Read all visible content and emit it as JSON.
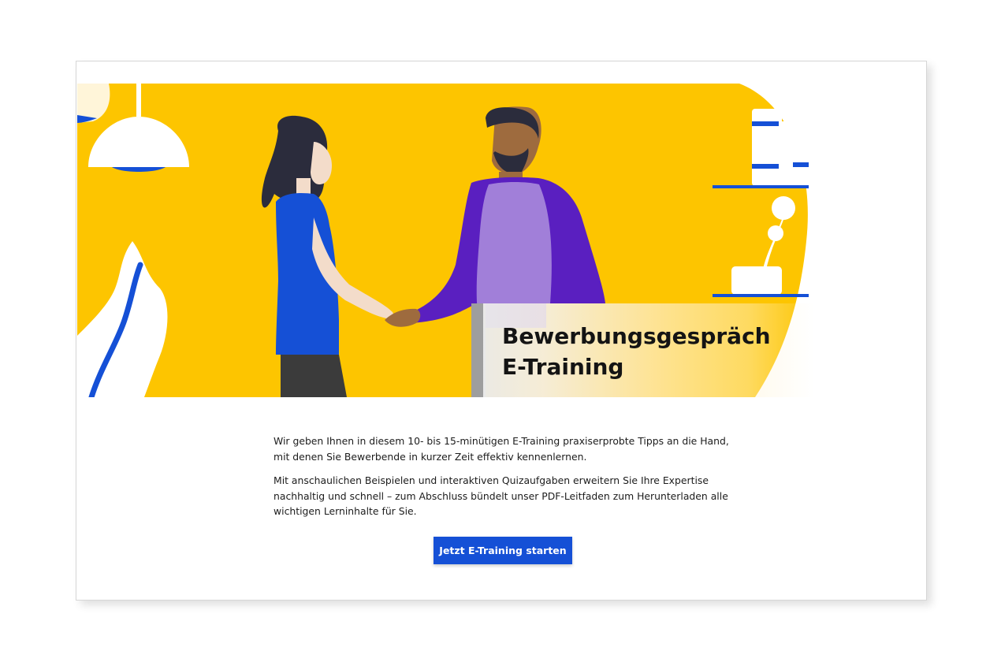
{
  "hero": {
    "title_line1": "Bewerbungsgespräch",
    "title_line2": "E-Training",
    "colors": {
      "background": "#fdc500",
      "blue": "#1550d6",
      "purple": "#5a1fc0",
      "lavender": "#a17fd9"
    }
  },
  "content": {
    "paragraph1_line1": "Wir geben Ihnen in diesem 10- bis 15-minütigen E-Training praxiserprobte Tipps an die Hand,",
    "paragraph1_line2": "mit denen Sie Bewerbende in kurzer Zeit effektiv kennenlernen.",
    "paragraph2_line1": "Mit anschaulichen Beispielen und interaktiven Quizaufgaben erweitern Sie Ihre Expertise",
    "paragraph2_line2": "nachhaltig und schnell – zum Abschluss bündelt unser PDF-Leitfaden zum Herunterladen alle",
    "paragraph2_line3": "wichtigen Lerninhalte für Sie."
  },
  "cta": {
    "label": "Jetzt E-Training starten",
    "color": "#1550d6"
  }
}
